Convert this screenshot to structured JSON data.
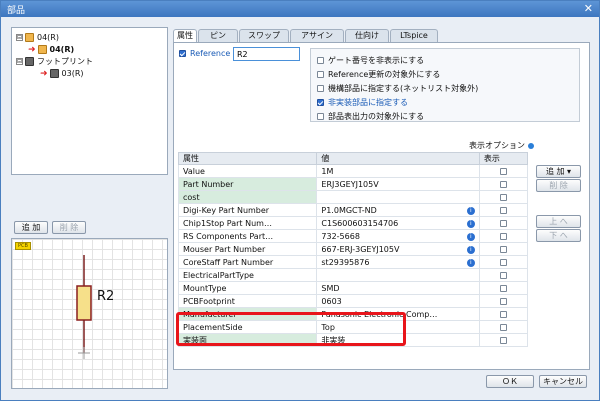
{
  "window": {
    "title": "部品",
    "close_glyph": "✕"
  },
  "tree": {
    "items": [
      {
        "label": "04(R)",
        "expander": "⊟"
      },
      {
        "label": "04(R)"
      },
      {
        "label": "フットプリント",
        "expander": "⊟"
      },
      {
        "label": "03(R)"
      }
    ]
  },
  "left_buttons": {
    "add": "追 加",
    "delete": "削 除"
  },
  "preview": {
    "badge": "PCB",
    "label": "R2"
  },
  "tabs": [
    "属性",
    "ピン",
    "スワップ",
    "アサイン",
    "仕向け",
    "LTspice"
  ],
  "reference": {
    "label": "Reference",
    "value": "R2"
  },
  "options": [
    {
      "label": "ゲート番号を非表示にする",
      "checked": false
    },
    {
      "label": "Reference更新の対象外にする",
      "checked": false
    },
    {
      "label": "機構部品に指定する(ネットリスト対象外)",
      "checked": false
    },
    {
      "label": "非実装部品に指定する",
      "checked": true
    },
    {
      "label": "部品表出力の対象外にする",
      "checked": false
    }
  ],
  "display_options": "表示オプション",
  "grid": {
    "headers": [
      "属性",
      "値",
      "表示"
    ],
    "rows": [
      {
        "name": "Value",
        "value": "1M",
        "hl": false,
        "info": false
      },
      {
        "name": "Part Number",
        "value": "ERJ3GEYJ105V",
        "hl": true,
        "info": false
      },
      {
        "name": "cost",
        "value": "",
        "hl": true,
        "info": false
      },
      {
        "name": "Digi-Key Part Number",
        "value": "P1.0MGCT-ND",
        "hl": false,
        "info": true
      },
      {
        "name": "Chip1Stop Part Num…",
        "value": "C1S600603154706",
        "hl": false,
        "info": true
      },
      {
        "name": "RS Components Part…",
        "value": "732-5668",
        "hl": false,
        "info": true
      },
      {
        "name": "Mouser Part Number",
        "value": "667-ERJ-3GEYJ105V",
        "hl": false,
        "info": true
      },
      {
        "name": "CoreStaff Part Number",
        "value": "st29395876",
        "hl": false,
        "info": true
      },
      {
        "name": "ElectricalPartType",
        "value": "",
        "hl": false,
        "info": false
      },
      {
        "name": "MountType",
        "value": "SMD",
        "hl": false,
        "info": false
      },
      {
        "name": "PCBFootprint",
        "value": "0603",
        "hl": false,
        "info": false
      },
      {
        "name": "Manufacturer",
        "value": "Panasonic Electronic Comp…",
        "hl": true,
        "info": false
      },
      {
        "name": "PlacementSide",
        "value": "Top",
        "hl": false,
        "info": false
      },
      {
        "name": "実装面",
        "value": "非実装",
        "hl": true,
        "info": false
      }
    ]
  },
  "right_buttons": {
    "add": "追 加 ▾",
    "delete": "削 除",
    "up": "上 へ",
    "down": "下 へ"
  },
  "footer": {
    "ok": "ＯＫ",
    "cancel": "キャンセル"
  }
}
